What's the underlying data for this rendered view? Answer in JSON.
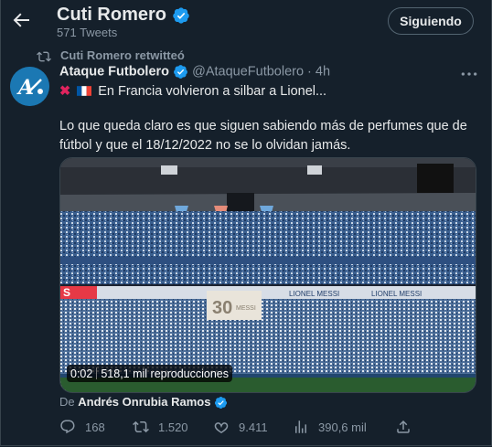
{
  "header": {
    "title": "Cuti Romero",
    "tweet_count": "571 Tweets",
    "follow_label": "Siguiendo"
  },
  "retweet": {
    "label": "Cuti Romero retwitteó"
  },
  "tweet": {
    "author_name": "Ataque Futbolero",
    "author_handle": "@AtaqueFutbolero",
    "time": " · 4h",
    "line1_text": "En Francia volvieron a silbar a Lionel...",
    "body": "Lo que queda claro es que siguen sabiendo más de perfumes que de fútbol y que el 18/12/2022 no se lo olvidan jamás.",
    "avatar_text": "A",
    "video": {
      "duration": "0:02",
      "views": "518,1 mil reproducciones",
      "screen_text": "LIONEL MESSI",
      "banner_text": "30",
      "banner_sub": "MESSI"
    },
    "from_prefix": "De ",
    "from_source": "Andrés Onrubia Ramos"
  },
  "actions": {
    "replies": "168",
    "retweets": "1.520",
    "likes": "9.411",
    "views": "390,6 mil"
  },
  "colors": {
    "background": "#15202b",
    "verified": "#1d9bf0",
    "muted": "#8b98a5"
  }
}
